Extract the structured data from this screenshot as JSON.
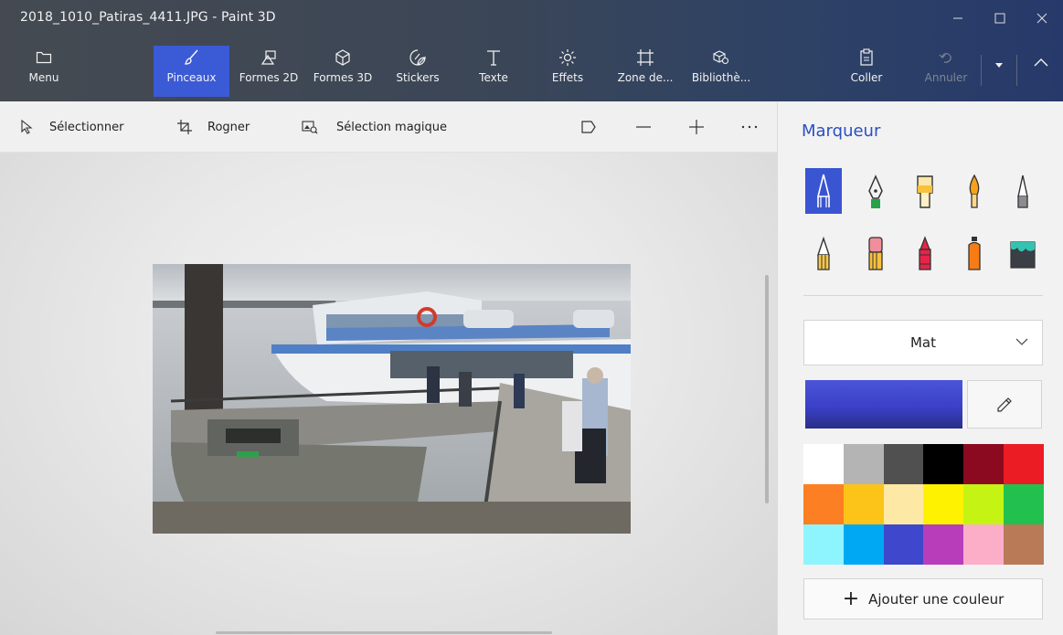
{
  "window": {
    "title": "2018_1010_Patiras_4411.JPG - Paint 3D",
    "controls": [
      "minimize-icon",
      "maximize-icon",
      "close-icon"
    ]
  },
  "ribbon": {
    "menu": "Menu",
    "tools": [
      {
        "id": "pinceaux",
        "label": "Pinceaux",
        "icon": "brush-icon",
        "active": true
      },
      {
        "id": "formes2d",
        "label": "Formes 2D",
        "icon": "shapes-2d-icon"
      },
      {
        "id": "formes3d",
        "label": "Formes 3D",
        "icon": "cube-icon"
      },
      {
        "id": "stickers",
        "label": "Stickers",
        "icon": "sticker-icon"
      },
      {
        "id": "texte",
        "label": "Texte",
        "icon": "text-icon"
      },
      {
        "id": "effets",
        "label": "Effets",
        "icon": "sun-icon"
      },
      {
        "id": "zone",
        "label": "Zone de...",
        "icon": "canvas-icon"
      },
      {
        "id": "bibliotheque",
        "label": "Bibliothè...",
        "icon": "library-icon"
      }
    ],
    "paste": "Coller",
    "undo": "Annuler"
  },
  "subtoolbar": {
    "select": "Sélectionner",
    "crop": "Rogner",
    "magic_select": "Sélection magique"
  },
  "panel": {
    "title": "Marqueur",
    "brushes": [
      "marker-icon",
      "calligraphy-pen-icon",
      "oil-brush-icon",
      "watercolor-icon",
      "pixel-pen-icon",
      "pencil-icon",
      "eraser-icon",
      "crayon-icon",
      "spray-can-icon",
      "fill-bucket-icon"
    ],
    "finish": "Mat",
    "current_color": "#3a40c8",
    "palette": [
      "#ffffff",
      "#b4b4b4",
      "#505050",
      "#000000",
      "#8b0a1f",
      "#ec1c24",
      "#fd7f23",
      "#fcc418",
      "#fde9a5",
      "#fff200",
      "#c5f414",
      "#22c04e",
      "#8ef5ff",
      "#00a8f3",
      "#3f47cc",
      "#b83dba",
      "#fcaec9",
      "#b97a57"
    ],
    "add_color": "Ajouter une couleur"
  }
}
